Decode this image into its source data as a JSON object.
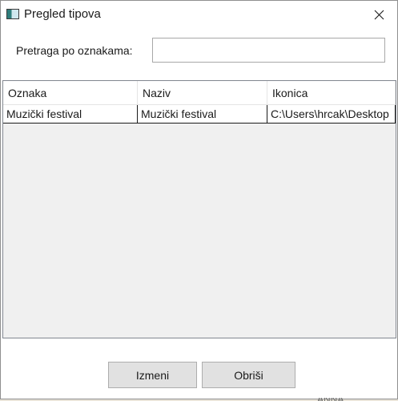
{
  "window": {
    "title": "Pregled tipova",
    "icon": "app-window-icon",
    "close_icon": "close-icon"
  },
  "search": {
    "label": "Pretraga po oznakama:",
    "value": "",
    "placeholder": ""
  },
  "table": {
    "columns": [
      "Oznaka",
      "Naziv",
      "Ikonica"
    ],
    "rows": [
      [
        "Muzički festival",
        "Muzički festival",
        "C:\\Users\\hrcak\\Desktop"
      ]
    ]
  },
  "buttons": {
    "edit_label": "Izmeni",
    "delete_label": "Obriši"
  },
  "background": {
    "partial_text": "ANNA"
  }
}
